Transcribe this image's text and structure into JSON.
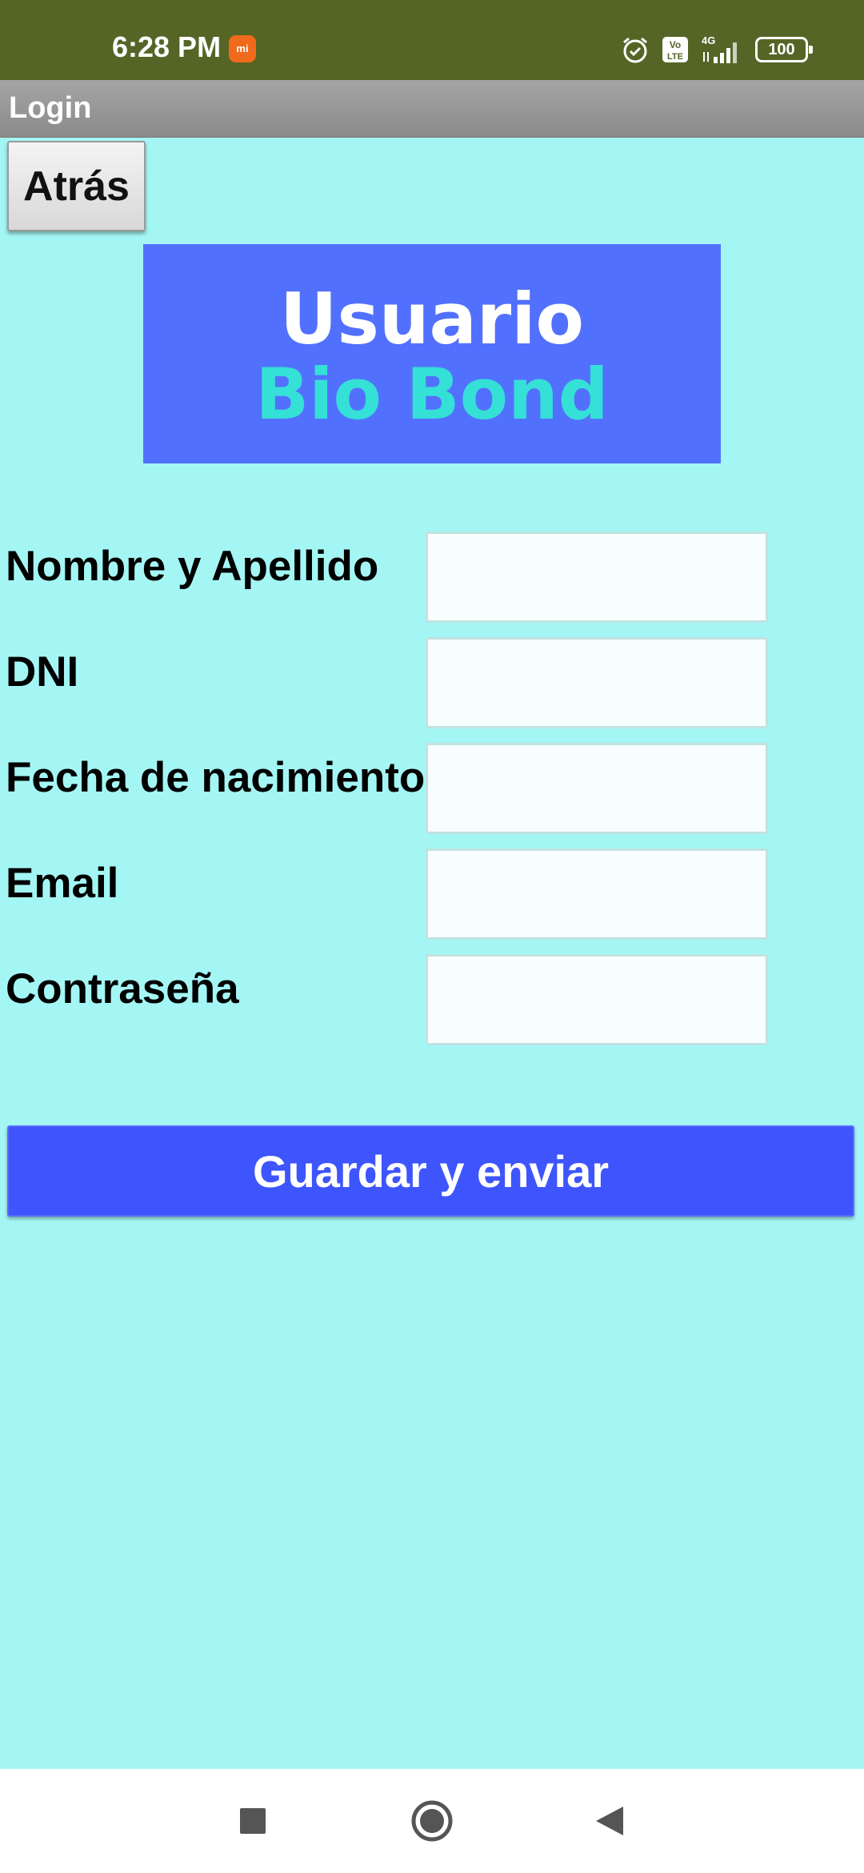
{
  "status_bar": {
    "time": "6:28 PM",
    "icons": [
      "mi-app-icon",
      "alarm-icon",
      "volte-icon",
      "signal-4g-icon",
      "battery-icon"
    ],
    "volte_label": "Vo LTE",
    "network_label": "4G",
    "battery_level": "100",
    "background_color": "#556526"
  },
  "app_bar": {
    "title": "Login"
  },
  "back_button": {
    "label": "Atrás"
  },
  "banner": {
    "line1": "Usuario",
    "line2": "Bio Bond",
    "background_color": "#5270fe",
    "line2_color": "#35e0d6"
  },
  "form": {
    "fields": [
      {
        "label": "Nombre y Apellido",
        "value": ""
      },
      {
        "label": "DNI",
        "value": ""
      },
      {
        "label": "Fecha de nacimiento",
        "value": ""
      },
      {
        "label": "Email",
        "value": ""
      },
      {
        "label": "Contraseña",
        "value": ""
      }
    ],
    "submit_label": "Guardar y enviar",
    "submit_color": "#3e55fe"
  },
  "page": {
    "background_color": "#a4f6f4"
  },
  "nav_bar": {
    "buttons": [
      "recents-icon",
      "home-icon",
      "back-icon"
    ]
  }
}
